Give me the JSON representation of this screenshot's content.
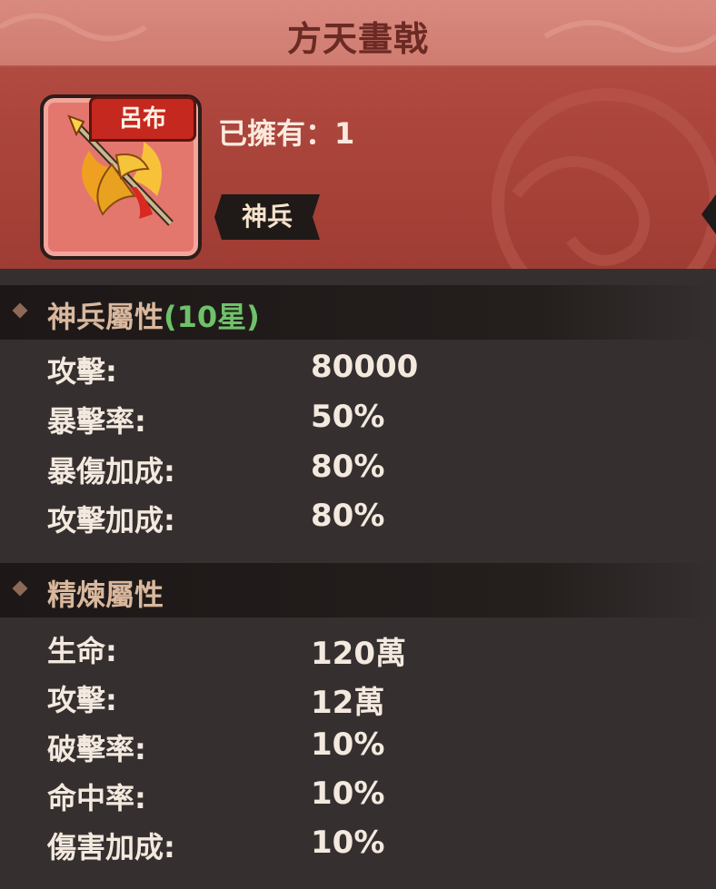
{
  "title": "方天畫戟",
  "item": {
    "owner_tag": "呂布",
    "owned_label": "已擁有：1",
    "type_badge": "神兵",
    "icon": "halberd-icon"
  },
  "sections": [
    {
      "title": "神兵屬性",
      "stars_label": "(10星)",
      "rows": [
        {
          "key": "攻擊:",
          "value": "80000"
        },
        {
          "key": "暴擊率:",
          "value": "50%"
        },
        {
          "key": "暴傷加成:",
          "value": "80%"
        },
        {
          "key": "攻擊加成:",
          "value": "80%"
        }
      ]
    },
    {
      "title": "精煉屬性",
      "rows": [
        {
          "key": "生命:",
          "value": "120萬"
        },
        {
          "key": "攻擊:",
          "value": "12萬"
        },
        {
          "key": "破擊率:",
          "value": "10%"
        },
        {
          "key": "命中率:",
          "value": "10%"
        },
        {
          "key": "傷害加成:",
          "value": "10%"
        }
      ]
    }
  ],
  "colors": {
    "title_bar": "#d98a7f",
    "header": "#b14a40",
    "panel": "#35302f",
    "star_green": "#6ec26a"
  }
}
